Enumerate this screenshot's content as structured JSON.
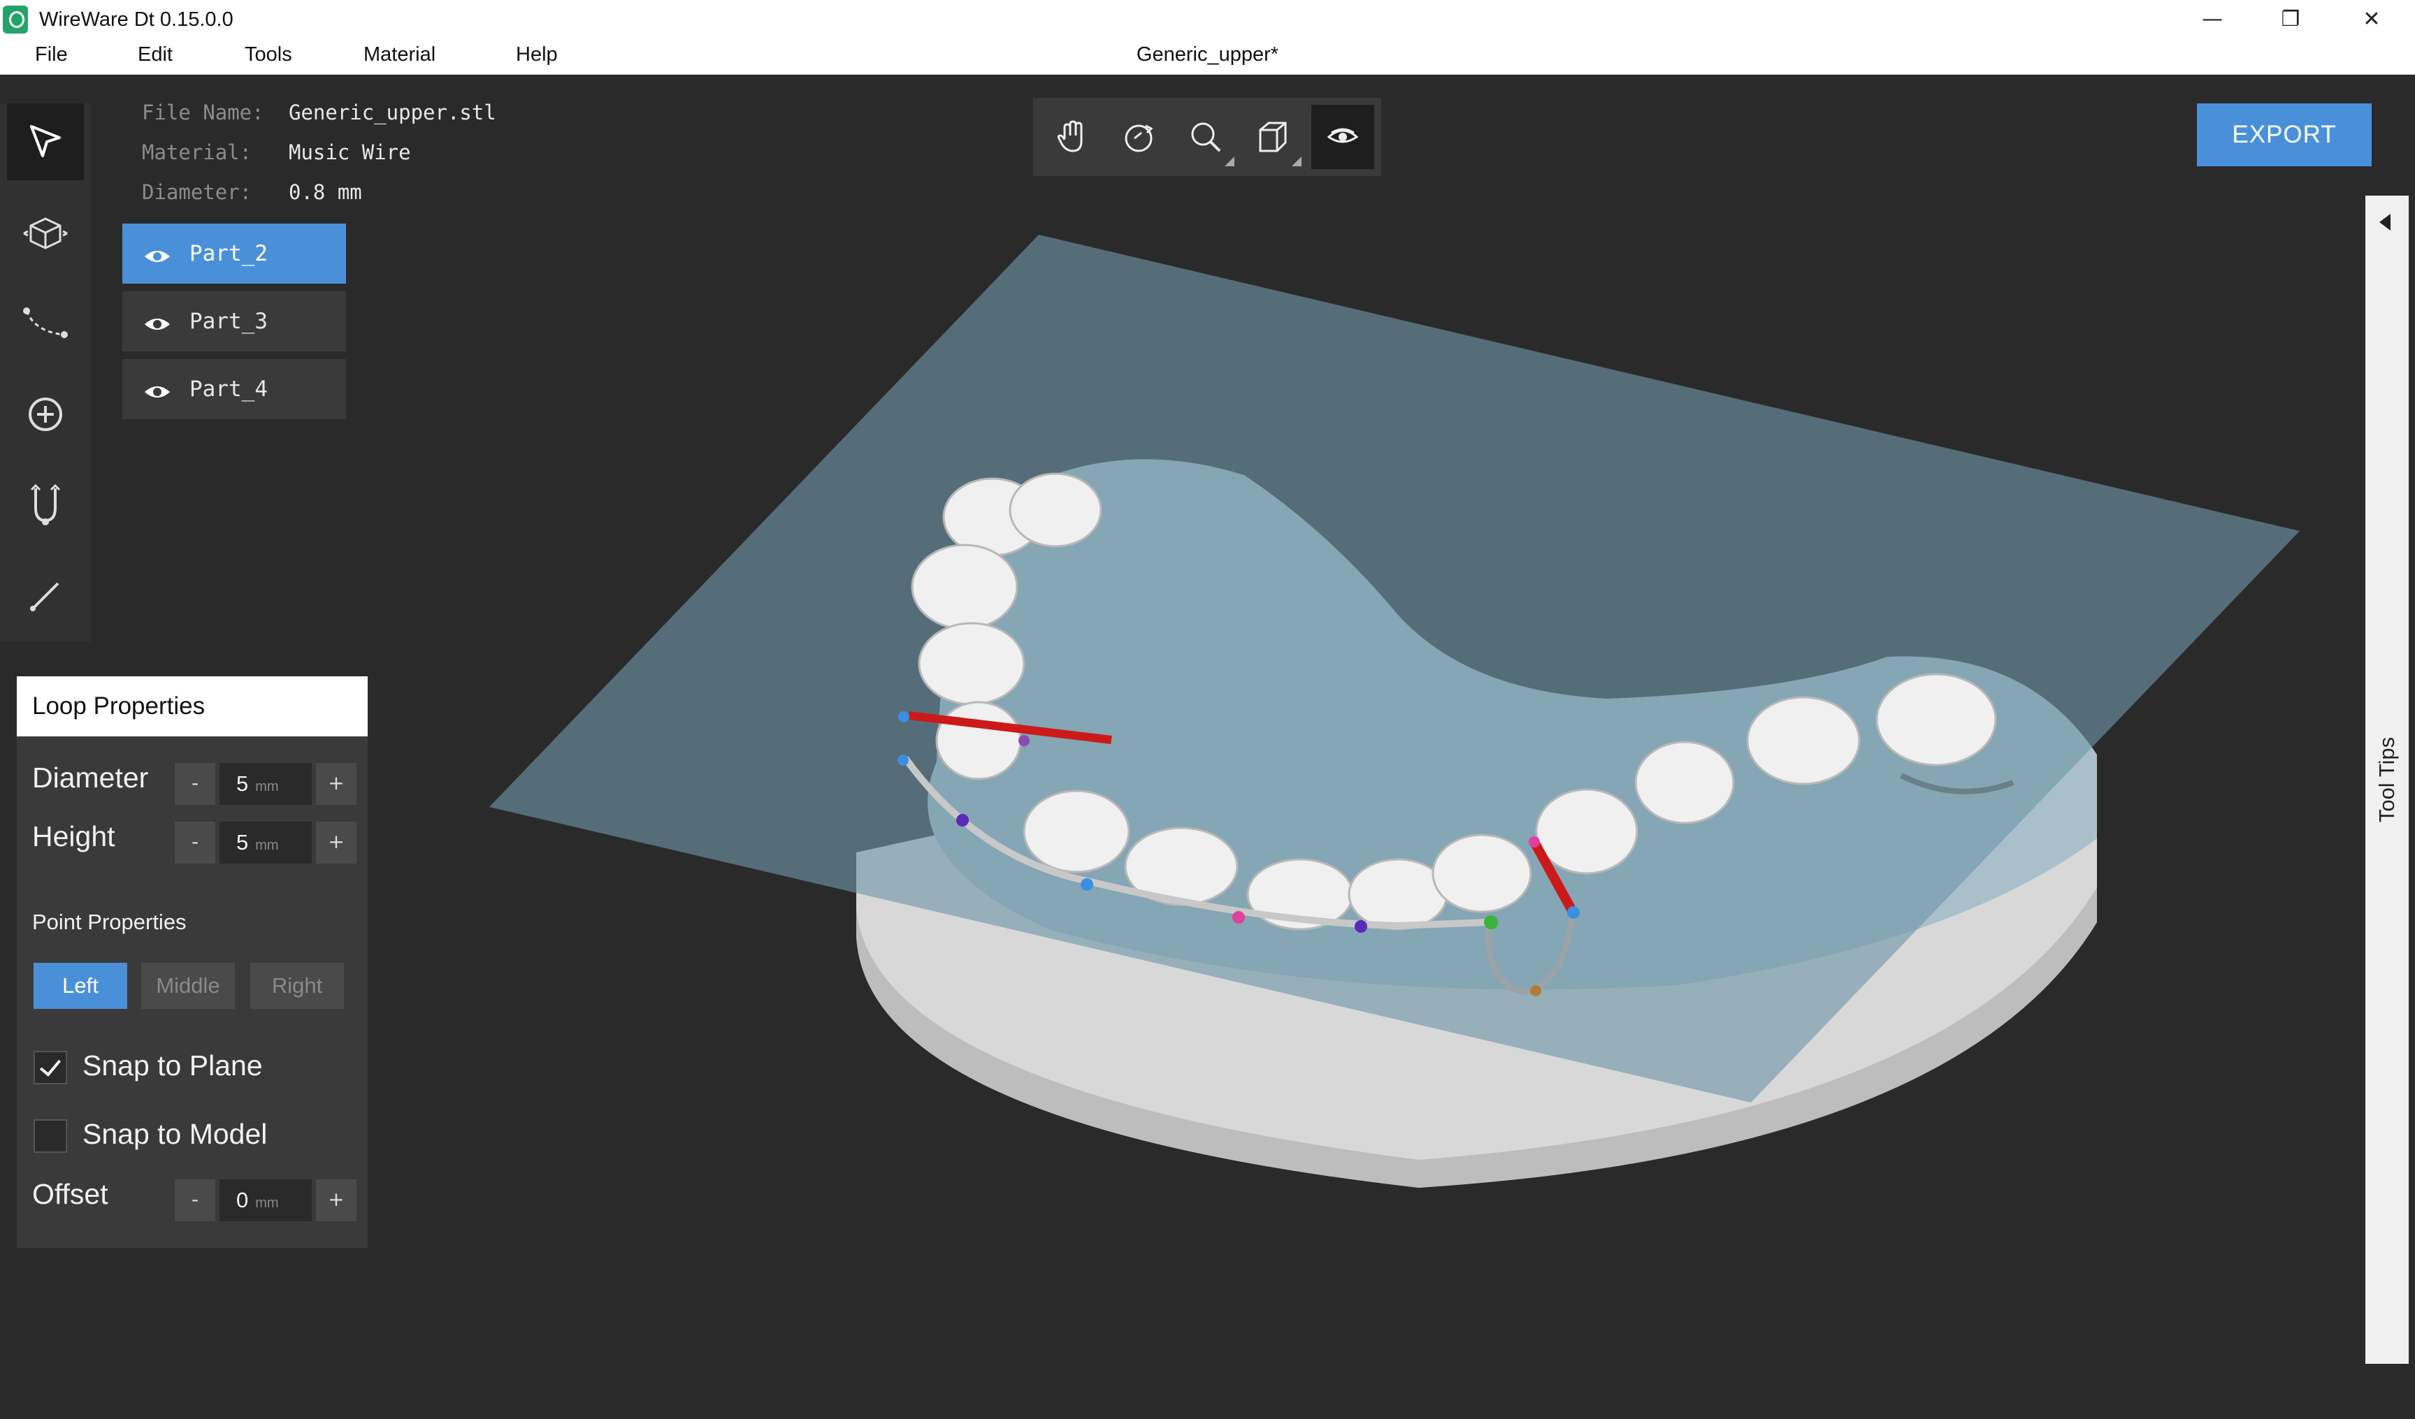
{
  "app": {
    "title": "WireWare Dt 0.15.0.0",
    "document_title": "Generic_upper*"
  },
  "window_controls": {
    "minimize": "—",
    "restore": "❐",
    "close": "✕"
  },
  "menu": [
    "File",
    "Edit",
    "Tools",
    "Material",
    "Help"
  ],
  "left_toolbar": [
    {
      "name": "select-tool",
      "icon": "cursor-arrow-icon",
      "active": true
    },
    {
      "name": "model-tool",
      "icon": "cube-icon",
      "active": false
    },
    {
      "name": "wire-path-tool",
      "icon": "dotted-curve-icon",
      "active": false
    },
    {
      "name": "add-point-tool",
      "icon": "plus-circle-icon",
      "active": false
    },
    {
      "name": "loop-tool",
      "icon": "u-loop-icon",
      "active": false
    },
    {
      "name": "line-tool",
      "icon": "line-icon",
      "active": false
    }
  ],
  "file_info": {
    "file_name_label": "File Name:",
    "file_name": "Generic_upper.stl",
    "material_label": "Material:",
    "material": "Music Wire",
    "diameter_label": "Diameter:",
    "diameter": "0.8 mm"
  },
  "parts": [
    {
      "label": "Part_2",
      "selected": true
    },
    {
      "label": "Part_3",
      "selected": false
    },
    {
      "label": "Part_4",
      "selected": false
    }
  ],
  "view_toolbar": [
    "pan-hand-icon",
    "orbit-icon",
    "zoom-icon",
    "view-cube-icon",
    "visibility-eye-icon"
  ],
  "export_label": "EXPORT",
  "tool_tips_label": "Tool Tips",
  "loop_properties": {
    "title": "Loop Properties",
    "diameter": {
      "label": "Diameter",
      "minus": "-",
      "value": "5",
      "unit": "mm",
      "plus": "+"
    },
    "height": {
      "label": "Height",
      "minus": "-",
      "value": "5",
      "unit": "mm",
      "plus": "+"
    },
    "point_properties_label": "Point Properties",
    "point_buttons": [
      "Left",
      "Middle",
      "Right"
    ],
    "active_point": "Left",
    "snap_to_plane": {
      "label": "Snap to Plane",
      "checked": true
    },
    "snap_to_model": {
      "label": "Snap to Model",
      "checked": false
    },
    "offset": {
      "label": "Offset",
      "minus": "-",
      "value": "0",
      "unit": "mm",
      "plus": "+"
    }
  },
  "colors": {
    "accent": "#4a90d9",
    "background": "#2a2a2a",
    "plane": "#6f96a8",
    "model": "#e8e8e8",
    "wire": "#c8c8c8",
    "loop_leg": "#cc1a1a"
  }
}
